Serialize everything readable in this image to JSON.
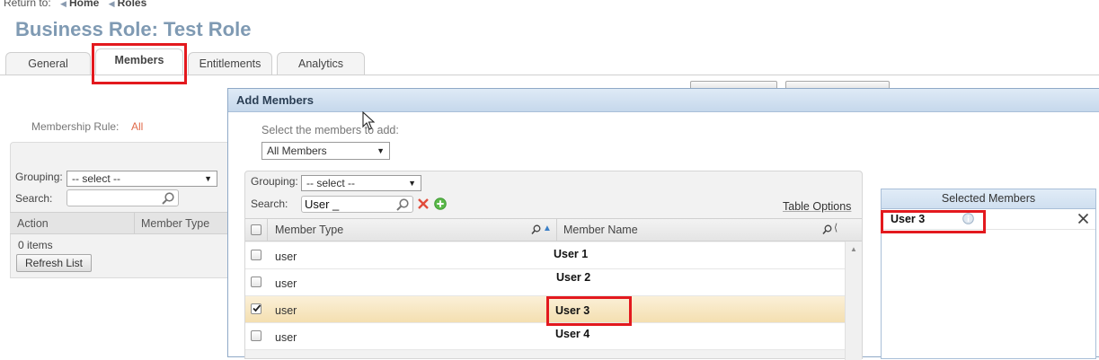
{
  "breadcrumb": {
    "prefix": "Return to:",
    "items": [
      "Home",
      "Roles"
    ]
  },
  "page_title": "Business Role: Test Role",
  "tabs": [
    "General",
    "Members",
    "Entitlements",
    "Analytics"
  ],
  "active_tab": "Members",
  "background_page": {
    "membership_rule_label": "Membership Rule:",
    "membership_rule_value": "All",
    "grouping_label": "Grouping:",
    "grouping_value": "-- select --",
    "search_label": "Search:",
    "search_value": "",
    "columns": [
      "Action",
      "Member Type"
    ],
    "item_count": "0 items",
    "refresh_button": "Refresh List"
  },
  "dialog": {
    "title": "Add Members",
    "select_prompt": "Select the members to add:",
    "member_filter": "All Members",
    "grouping_label": "Grouping:",
    "grouping_value": "-- select --",
    "search_label": "Search:",
    "search_value": "User _",
    "table_options": "Table Options",
    "columns": [
      "Member Type",
      "Member Name"
    ],
    "rows": [
      {
        "type": "user",
        "name": "User 1",
        "checked": false
      },
      {
        "type": "user",
        "name": "User 2",
        "checked": false
      },
      {
        "type": "user",
        "name": "User 3",
        "checked": true
      },
      {
        "type": "user",
        "name": "User 4",
        "checked": false
      }
    ],
    "selected_panel": {
      "title": "Selected Members",
      "items": [
        {
          "name": "User 3"
        }
      ]
    }
  },
  "colors": {
    "title": "#7f9ab3",
    "highlight_box": "#e3191e",
    "selected_row": "#f4dfb0",
    "dialog_header": "#c6d8ec"
  },
  "icons": [
    "search-icon",
    "clear-search-icon",
    "add-icon",
    "sort-asc-icon",
    "remove-icon",
    "info-icon",
    "mouse-cursor-icon"
  ]
}
